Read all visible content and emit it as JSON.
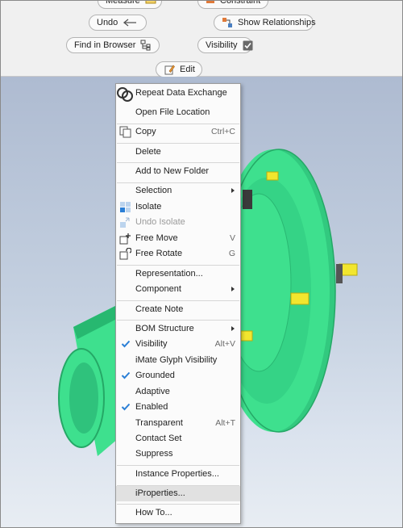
{
  "marking_menu": {
    "measure": "Measure",
    "constraint": "Constraint",
    "undo": "Undo",
    "show_relationships": "Show Relationships",
    "find_in_browser": "Find in Browser",
    "visibility": "Visibility",
    "visibility_checked": true,
    "edit": "Edit"
  },
  "context_menu": {
    "repeat_data_exchange": "Repeat Data Exchange",
    "open_file_location": "Open File Location",
    "copy": "Copy",
    "copy_shortcut": "Ctrl+C",
    "delete": "Delete",
    "add_to_new_folder": "Add to New Folder",
    "selection": "Selection",
    "isolate": "Isolate",
    "undo_isolate": "Undo Isolate",
    "free_move": "Free Move",
    "free_move_shortcut": "V",
    "free_rotate": "Free Rotate",
    "free_rotate_shortcut": "G",
    "representation": "Representation...",
    "component": "Component",
    "create_note": "Create Note",
    "bom_structure": "BOM Structure",
    "visibility": "Visibility",
    "visibility_shortcut": "Alt+V",
    "imate_glyph_visibility": "iMate Glyph Visibility",
    "grounded": "Grounded",
    "adaptive": "Adaptive",
    "enabled": "Enabled",
    "transparent": "Transparent",
    "transparent_shortcut": "Alt+T",
    "contact_set": "Contact Set",
    "suppress": "Suppress",
    "instance_properties": "Instance Properties...",
    "iproperties": "iProperties...",
    "how_to": "How To..."
  },
  "checked_items": [
    "Visibility",
    "Grounded",
    "Enabled"
  ],
  "highlighted_item": "iProperties...",
  "colors": {
    "part_body": "#3ee08e",
    "part_shade": "#27b870",
    "bolt": "#f2e62e",
    "check_blue": "#2b7fd6"
  }
}
